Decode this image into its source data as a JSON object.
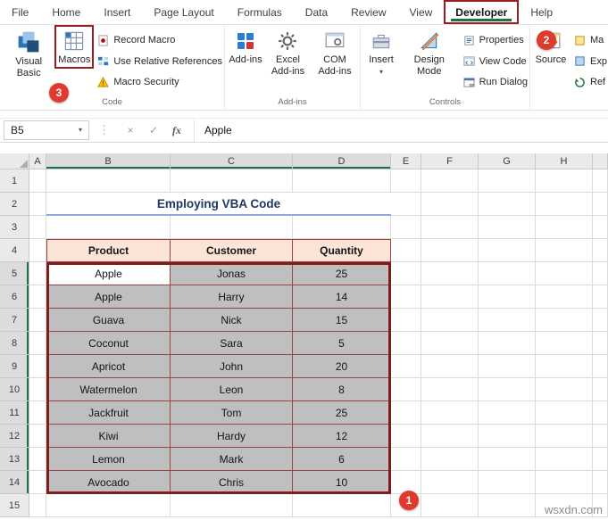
{
  "tab_bar": {
    "tabs": [
      "File",
      "Home",
      "Insert",
      "Page Layout",
      "Formulas",
      "Data",
      "Review",
      "View",
      "Developer",
      "Help"
    ],
    "active_tab": "Developer"
  },
  "ribbon": {
    "code": {
      "label": "Code",
      "visual_basic": "Visual Basic",
      "macros": "Macros",
      "record_macro": "Record Macro",
      "use_relative_references": "Use Relative References",
      "macro_security": "Macro Security"
    },
    "addins": {
      "label": "Add-ins",
      "addins_button": "Add-ins",
      "excel_addins": "Excel Add-ins",
      "com_addins": "COM Add-ins"
    },
    "controls": {
      "label": "Controls",
      "insert": "Insert",
      "design_mode": "Design Mode",
      "properties": "Properties",
      "view_code": "View Code",
      "run_dialog": "Run Dialog"
    },
    "xml": {
      "source": "Source",
      "partial_items": [
        "Ma",
        "Exp",
        "Ref"
      ]
    }
  },
  "formula_bar": {
    "name_box": "B5",
    "fx_label": "fx",
    "value": "Apple"
  },
  "grid": {
    "column_headers": [
      "A",
      "B",
      "C",
      "D",
      "E",
      "F",
      "G",
      "H"
    ],
    "row_count": 15,
    "selected_columns": [
      "B",
      "C",
      "D"
    ],
    "selected_rows": [
      5,
      14
    ]
  },
  "sheet": {
    "title": "Employing VBA Code",
    "table": {
      "headers": [
        "Product",
        "Customer",
        "Quantity"
      ],
      "rows": [
        [
          "Apple",
          "Jonas",
          "25"
        ],
        [
          "Apple",
          "Harry",
          "14"
        ],
        [
          "Guava",
          "Nick",
          "15"
        ],
        [
          "Coconut",
          "Sara",
          "5"
        ],
        [
          "Apricot",
          "John",
          "20"
        ],
        [
          "Watermelon",
          "Leon",
          "8"
        ],
        [
          "Jackfruit",
          "Tom",
          "25"
        ],
        [
          "Kiwi",
          "Hardy",
          "12"
        ],
        [
          "Lemon",
          "Mark",
          "6"
        ],
        [
          "Avocado",
          "Chris",
          "10"
        ]
      ],
      "columns": [
        "B",
        "C",
        "D"
      ],
      "header_row": 4,
      "data_rows": [
        5,
        14
      ],
      "active_cell": "B5"
    }
  },
  "annotations": {
    "step1": "1",
    "step2": "2",
    "step3": "3"
  },
  "watermark": "wsxdn.com",
  "colors": {
    "excel_green": "#1E7145",
    "annotation_red": "#E03A2F",
    "box_red": "#9D1D1D",
    "table_header_bg": "#FCE4D6",
    "table_cell_bg": "#BFBFBF",
    "title_text": "#1F3864"
  }
}
